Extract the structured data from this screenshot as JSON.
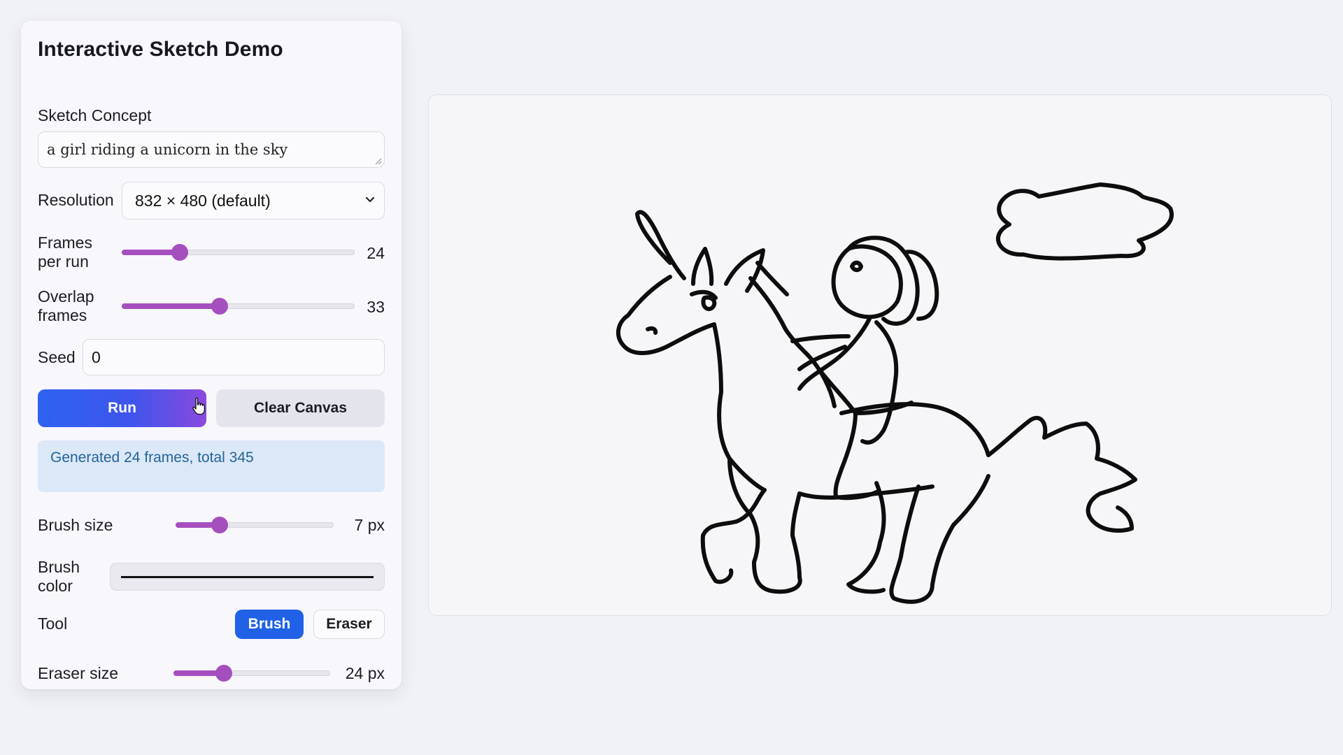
{
  "panel": {
    "title": "Interactive Sketch Demo",
    "concept": {
      "label": "Sketch Concept",
      "value": "a girl riding a unicorn in the sky"
    },
    "resolution": {
      "label": "Resolution",
      "selected": "832 × 480 (default)"
    },
    "frames_per_run": {
      "label_line1": "Frames",
      "label_line2": "per run",
      "value": 24,
      "display": "24",
      "slider_fraction": 0.25
    },
    "overlap_frames": {
      "label_line1": "Overlap",
      "label_line2": "frames",
      "value": 33,
      "display": "33",
      "slider_fraction": 0.42
    },
    "seed": {
      "label": "Seed",
      "value": "0"
    },
    "buttons": {
      "run": "Run",
      "clear_canvas": "Clear Canvas"
    },
    "status": "Generated 24 frames, total 345",
    "brush_size": {
      "label": "Brush size",
      "value": 7,
      "display": "7 px",
      "slider_fraction": 0.28
    },
    "brush_color": {
      "label_line1": "Brush",
      "label_line2": "color",
      "value": "#111111"
    },
    "tool": {
      "label": "Tool",
      "options": [
        "Brush",
        "Eraser"
      ],
      "selected": "Brush"
    },
    "eraser_size": {
      "label": "Eraser size",
      "value": 24,
      "display": "24 px",
      "slider_fraction": 0.32
    }
  },
  "colors": {
    "accent_purple": "#a54fbe",
    "primary_blue": "#2061e8",
    "status_bg": "#dbe8f8",
    "status_text": "#236396"
  }
}
